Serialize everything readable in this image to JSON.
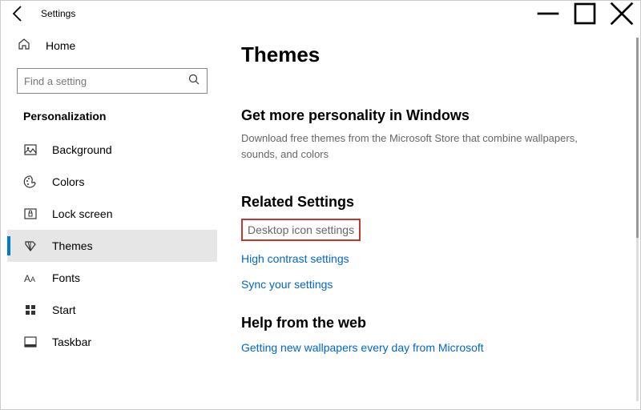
{
  "window": {
    "title": "Settings"
  },
  "sidebar": {
    "home_label": "Home",
    "search_placeholder": "Find a setting",
    "category": "Personalization",
    "items": [
      {
        "label": "Background"
      },
      {
        "label": "Colors"
      },
      {
        "label": "Lock screen"
      },
      {
        "label": "Themes"
      },
      {
        "label": "Fonts"
      },
      {
        "label": "Start"
      },
      {
        "label": "Taskbar"
      }
    ]
  },
  "content": {
    "title": "Themes",
    "personality": {
      "heading": "Get more personality in Windows",
      "desc": "Download free themes from the Microsoft Store that combine wallpapers, sounds, and colors"
    },
    "related": {
      "heading": "Related Settings",
      "links": [
        "Desktop icon settings",
        "High contrast settings",
        "Sync your settings"
      ]
    },
    "help": {
      "heading": "Help from the web",
      "links": [
        "Getting new wallpapers every day from Microsoft"
      ]
    }
  }
}
